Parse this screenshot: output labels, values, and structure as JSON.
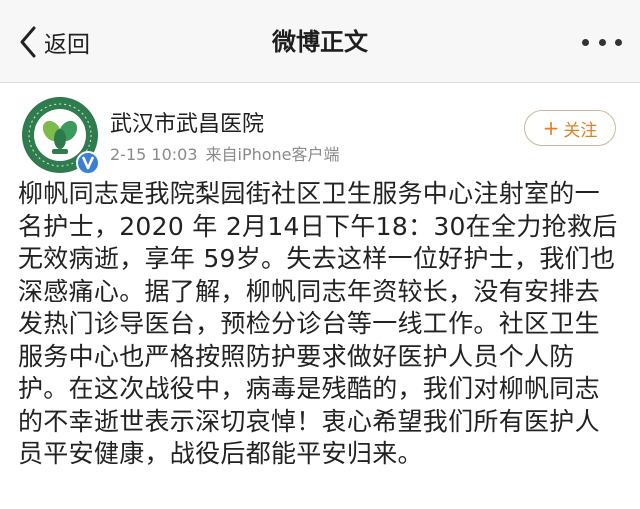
{
  "nav": {
    "back_label": "返回",
    "title": "微博正文"
  },
  "post": {
    "author": "武汉市武昌医院",
    "date": "2-15 10:03",
    "source": "来自iPhone客户端",
    "follow_label": "关注",
    "follow_plus": "+",
    "lines": [
      "柳帆同志是我院梨园街社区卫生服务中心注射室的一",
      "名护士，2020 年 2月14日下午18：30在全力抢救后",
      "无效病逝，享年 59岁。失去这样一位好护士，我们也",
      "深感痛心。据了解，柳帆同志年资较长，没有安排去",
      "发热门诊导医台，预检分诊台等一线工作。社区卫生",
      "服务中心也严格按照防护要求做好医护人员个人防",
      "护。在这次战役中，病毒是残酷的，我们对柳帆同志",
      "的不幸逝世表示深切哀悼！衷心希望我们所有医护人",
      "员平安健康，战役后都能平安归来。"
    ]
  },
  "icons": {
    "back": "chevron-left-icon",
    "more": "more-dots-icon",
    "verified": "verified-badge-icon"
  },
  "colors": {
    "follow_text": "#e07f22",
    "verified": "#3b7fd6",
    "meta": "#8a8a8a"
  }
}
